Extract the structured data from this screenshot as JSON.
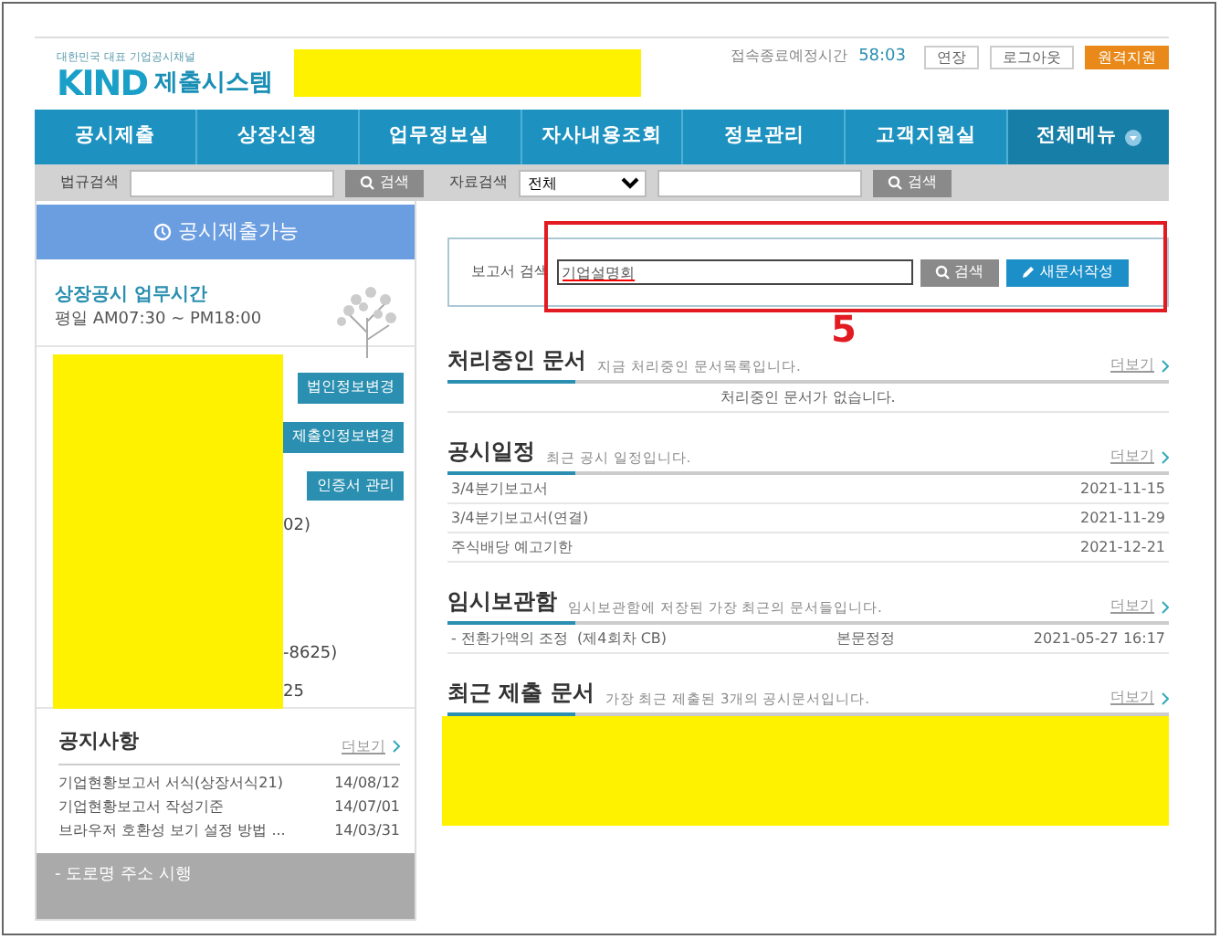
{
  "header": {
    "logo_tagline": "대한민국 대표 기업공시채널",
    "logo_mark": "KIND",
    "logo_title": "제출시스템",
    "session_label": "접속종료예정시간",
    "session_time": "58:03",
    "buttons": [
      {
        "label": "연장",
        "kind": "plain"
      },
      {
        "label": "로그아웃",
        "kind": "plain"
      },
      {
        "label": "원격지원",
        "kind": "accent"
      }
    ]
  },
  "nav": [
    {
      "label": "공시제출",
      "kind": "menu"
    },
    {
      "label": "상장신청",
      "kind": "menu"
    },
    {
      "label": "업무정보실",
      "kind": "menu"
    },
    {
      "label": "자사내용조회",
      "kind": "menu"
    },
    {
      "label": "정보관리",
      "kind": "menu"
    },
    {
      "label": "고객지원실",
      "kind": "menu"
    },
    {
      "label": "전체메뉴",
      "caret": true,
      "kind": "all"
    }
  ],
  "search_bar": {
    "law_label": "법규검색",
    "law_button": "검색",
    "doc_label": "자료검색",
    "doc_select": "전체",
    "doc_button": "검색"
  },
  "sidebar": {
    "status": "공시제출가능",
    "hours_title": "상장공시 업무시간",
    "hours": "평일 AM07:30 ~ PM18:00",
    "buttons": [
      "법인정보변경",
      "제출인정보변경",
      "인증서 관리"
    ],
    "fragments": [
      "02)",
      "-8625)",
      "25"
    ],
    "notice": {
      "title": "공지사항",
      "more": "더보기",
      "items": [
        {
          "title": "기업현황보고서 서식(상장서식21)",
          "date": "14/08/12"
        },
        {
          "title": "기업현황보고서 작성기준",
          "date": "14/07/01"
        },
        {
          "title": "브라우저 호환성 보기 설정 방법 ...",
          "date": "14/03/31"
        }
      ]
    },
    "banner": "- 도로명 주소 시행"
  },
  "report_search": {
    "label": "보고서 검색",
    "value": "기업설명회",
    "search_button": "검색",
    "new_button": "새문서작성"
  },
  "annotation": "5",
  "processing": {
    "title": "처리중인 문서",
    "subtitle": "지금 처리중인 문서목록입니다.",
    "more": "더보기",
    "empty": "처리중인 문서가 없습니다."
  },
  "schedule": {
    "title": "공시일정",
    "subtitle": "최근 공시 일정입니다.",
    "more": "더보기",
    "rows": [
      {
        "name": "3/4분기보고서",
        "date": "2021-11-15"
      },
      {
        "name": "3/4분기보고서(연결)",
        "date": "2021-11-29"
      },
      {
        "name": "주식배당 예고기한",
        "date": "2021-12-21"
      }
    ]
  },
  "drafts": {
    "title": "임시보관함",
    "subtitle": "임시보관함에 저장된 가장 최근의 문서들입니다.",
    "more": "더보기",
    "rows": [
      {
        "name": "- 전환가액의 조정  (제4회차 CB)",
        "type": "본문정정",
        "date": "2021-05-27 16:17"
      }
    ]
  },
  "recent": {
    "title": "최근 제출 문서",
    "subtitle": "가장 최근 제출된 3개의 공시문서입니다.",
    "more": "더보기"
  }
}
